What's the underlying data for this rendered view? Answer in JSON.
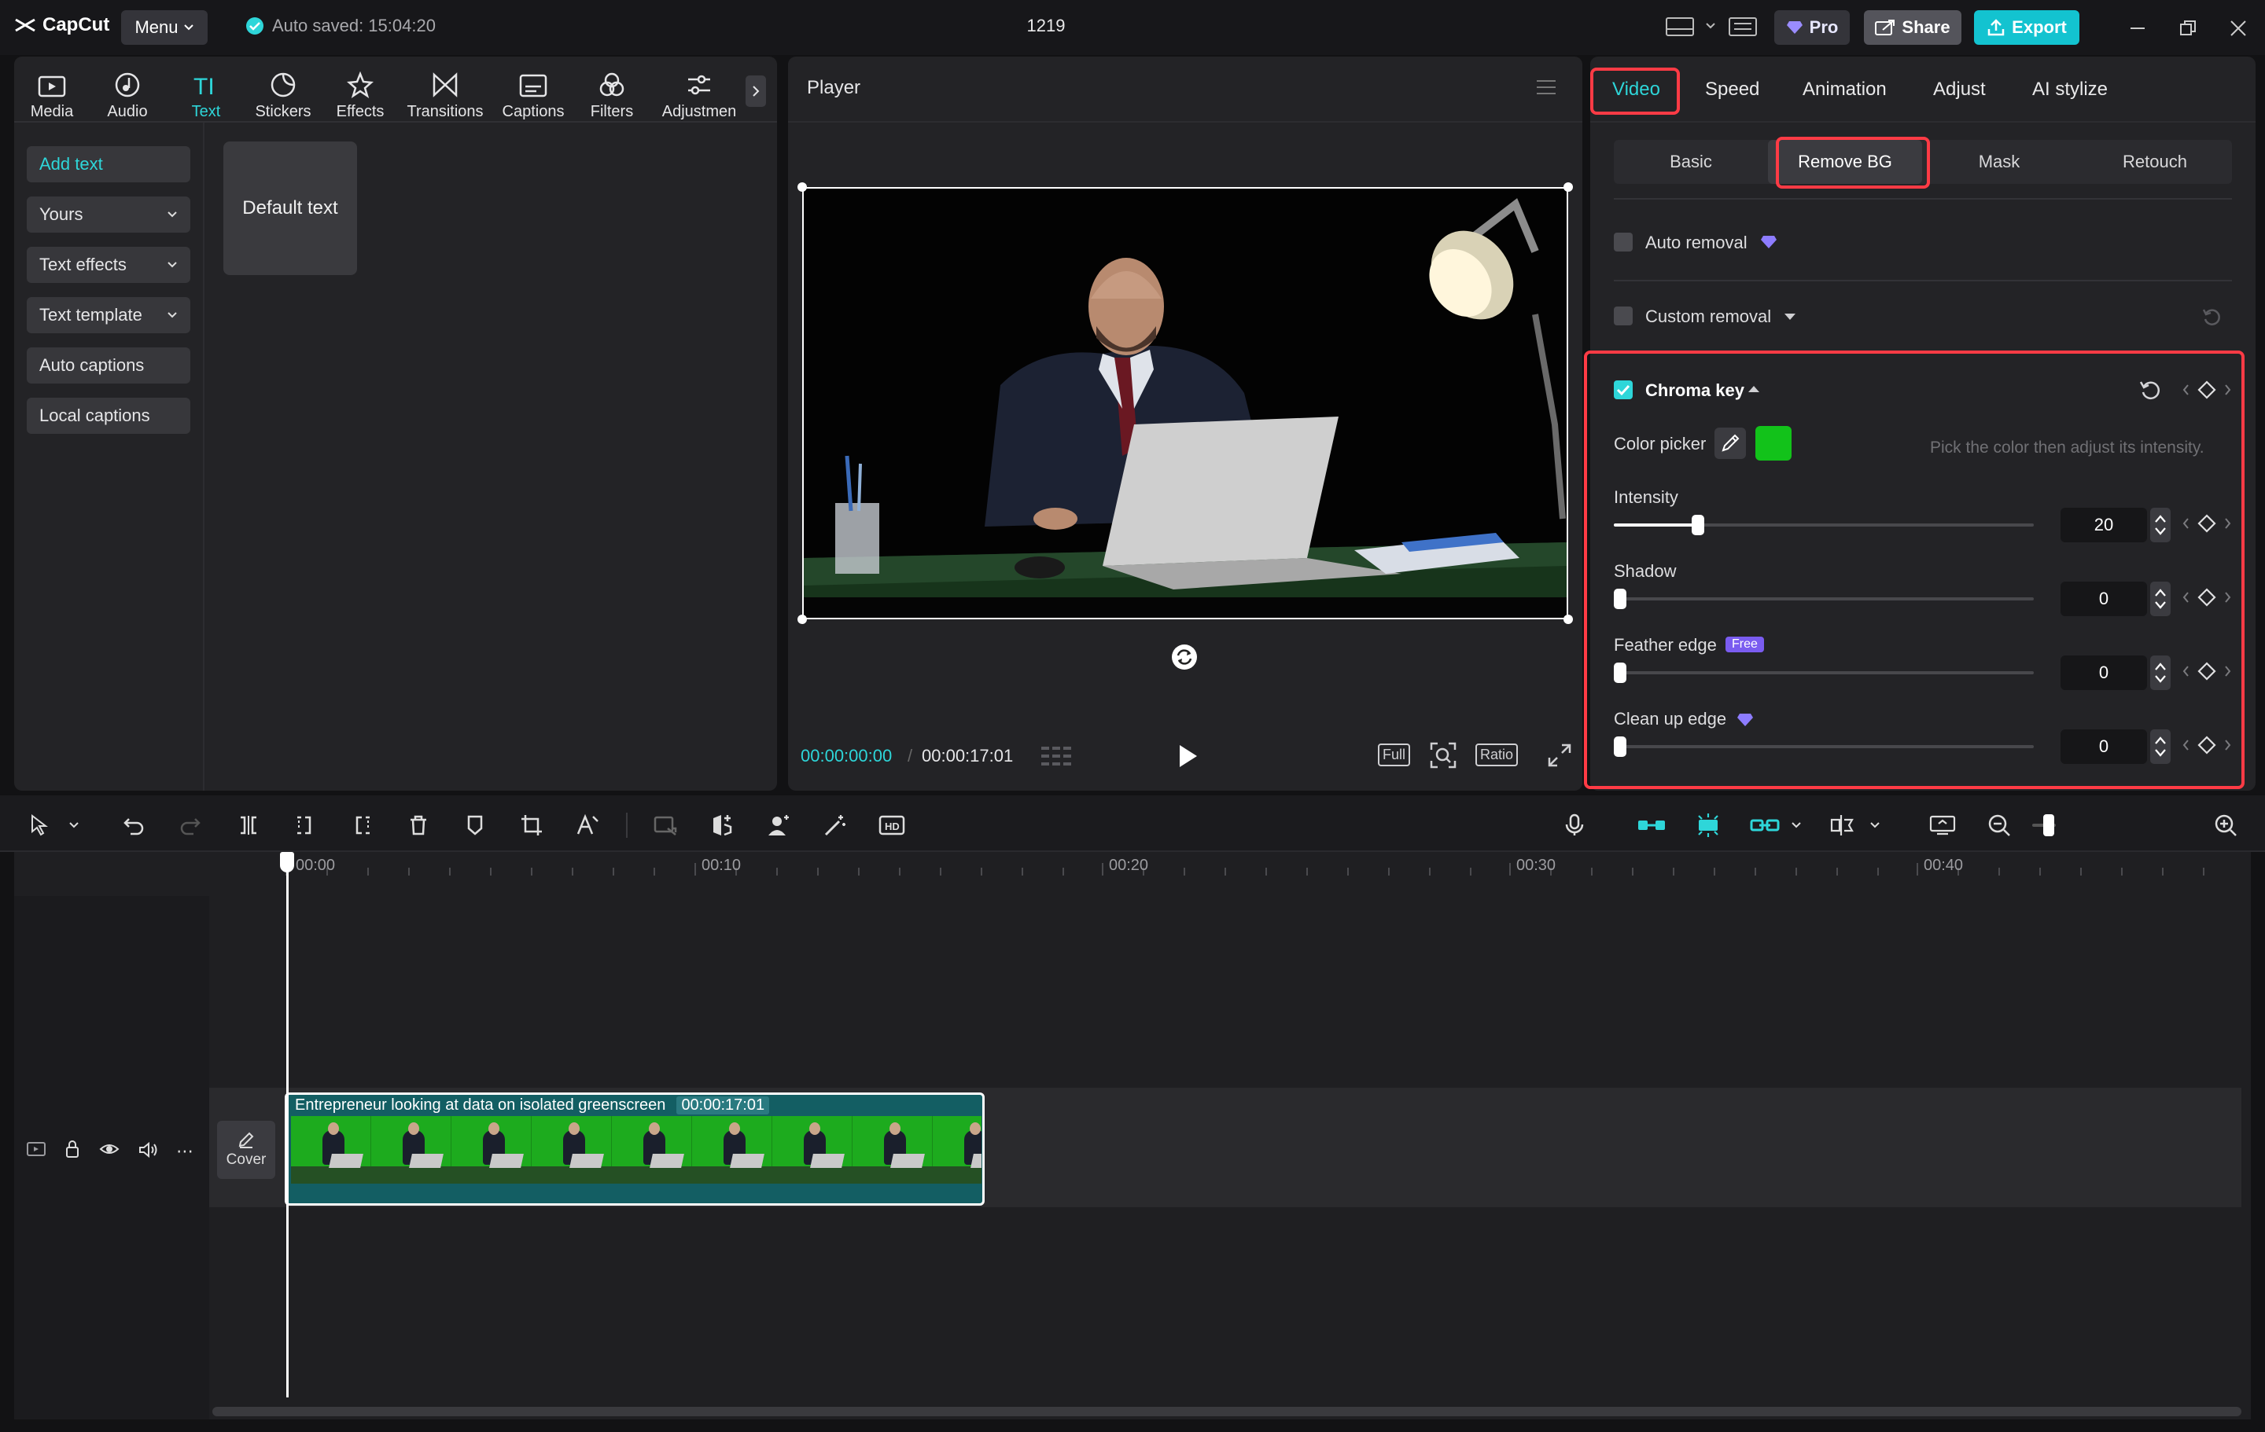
{
  "app": {
    "name": "CapCut",
    "menu_label": "Menu",
    "autosave": "Auto saved: 15:04:20",
    "project_title": "1219",
    "pro_label": "Pro",
    "share_label": "Share",
    "export_label": "Export"
  },
  "left_tabs": [
    {
      "label": "Media",
      "icon": "media-icon"
    },
    {
      "label": "Audio",
      "icon": "audio-icon"
    },
    {
      "label": "Text",
      "icon": "text-icon",
      "active": true
    },
    {
      "label": "Stickers",
      "icon": "stickers-icon"
    },
    {
      "label": "Effects",
      "icon": "effects-icon"
    },
    {
      "label": "Transitions",
      "icon": "transitions-icon"
    },
    {
      "label": "Captions",
      "icon": "captions-icon"
    },
    {
      "label": "Filters",
      "icon": "filters-icon"
    },
    {
      "label": "Adjustmen",
      "icon": "adjustment-icon"
    }
  ],
  "text_sidebar": {
    "items": [
      "Add text",
      "Yours",
      "Text effects",
      "Text template",
      "Auto captions",
      "Local captions"
    ],
    "default_text_card": "Default text"
  },
  "player": {
    "title": "Player",
    "current_time": "00:00:00:00",
    "total_time": "00:00:17:01",
    "btn_full": "Full",
    "btn_ratio": "Ratio"
  },
  "inspector": {
    "tabs": [
      "Video",
      "Speed",
      "Animation",
      "Adjust",
      "AI stylize"
    ],
    "subtabs": [
      "Basic",
      "Remove BG",
      "Mask",
      "Retouch"
    ],
    "auto_removal": "Auto removal",
    "custom_removal": "Custom removal",
    "chroma_key": {
      "title": "Chroma key",
      "checked": true,
      "color_picker_label": "Color picker",
      "picked_color": "#12c21a",
      "hint": "Pick the color then adjust its intensity.",
      "sliders": [
        {
          "label": "Intensity",
          "value": "20",
          "fraction": 0.2
        },
        {
          "label": "Shadow",
          "value": "0",
          "fraction": 0
        },
        {
          "label": "Feather edge",
          "value": "0",
          "fraction": 0,
          "badge": "Free"
        },
        {
          "label": "Clean up edge",
          "value": "0",
          "fraction": 0
        }
      ]
    }
  },
  "timeline": {
    "ticks": [
      "00:00",
      "00:10",
      "00:20",
      "00:30",
      "00:40"
    ],
    "clip_title": "Entrepreneur looking at data on isolated greenscreen",
    "clip_duration": "00:00:17:01",
    "cover_label": "Cover"
  },
  "colors": {
    "accent": "#2ed6d9",
    "highlight": "#ff3b45",
    "export_bg": "#13c3d0",
    "clip_bg": "#135e63"
  }
}
